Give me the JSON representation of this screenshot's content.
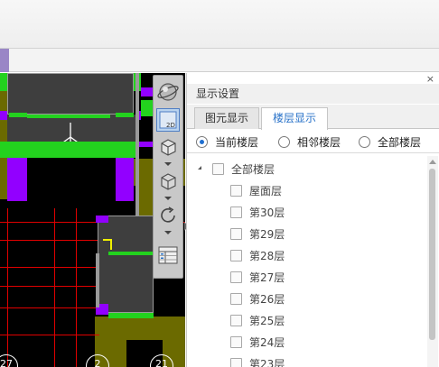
{
  "panel": {
    "title": "显示设置",
    "close_icon": "×",
    "tabs": [
      {
        "label": "图元显示",
        "active": false
      },
      {
        "label": "楼层显示",
        "active": true
      }
    ],
    "radio_options": [
      {
        "label": "当前楼层",
        "checked": true
      },
      {
        "label": "相邻楼层",
        "checked": false
      },
      {
        "label": "全部楼层",
        "checked": false
      }
    ],
    "tree_root": {
      "label": "全部楼层",
      "checked": false,
      "expanded": true
    },
    "floors": [
      {
        "label": "屋面层",
        "checked": false
      },
      {
        "label": "第30层",
        "checked": false
      },
      {
        "label": "第29层",
        "checked": false
      },
      {
        "label": "第28层",
        "checked": false
      },
      {
        "label": "第27层",
        "checked": false
      },
      {
        "label": "第26层",
        "checked": false
      },
      {
        "label": "第25层",
        "checked": false
      },
      {
        "label": "第24层",
        "checked": false
      },
      {
        "label": "第23层",
        "checked": false
      }
    ]
  },
  "viewport": {
    "axis_labels": [
      "27",
      "2",
      "21"
    ],
    "toolbar": {
      "icons": [
        "globe-icon",
        "2d-view-icon",
        "3d-box-icon",
        "3d-box-dropdown-icon",
        "rotate-icon",
        "floor-list-icon"
      ],
      "active_label": "2D"
    },
    "colors": {
      "background": "#000000",
      "slab": "#3e3e3e",
      "wall": "#6b6a00",
      "beam": "#23d21e",
      "column": "#9200ff",
      "grid_line": "#e00000",
      "frame": "#9a9a9a"
    }
  }
}
